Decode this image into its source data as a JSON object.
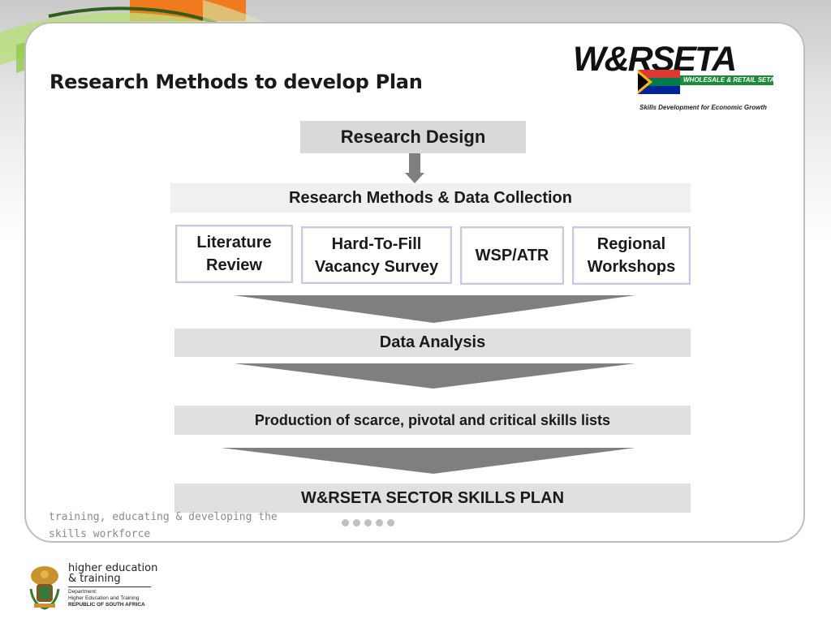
{
  "slide": {
    "title": "Research Methods to develop Plan",
    "footer_tagline": "training, educating & developing the\nskills workforce"
  },
  "logo": {
    "name": "W&RSETA",
    "band_text": "WHOLESALE & RETAIL SETA",
    "tagline": "Skills Development for Economic Growth"
  },
  "diagram": {
    "research_design": "Research Design",
    "methods_header": "Research Methods & Data Collection",
    "methods": [
      {
        "label": "Literature\nReview"
      },
      {
        "label": "Hard-To-Fill\nVacancy Survey"
      },
      {
        "label": "WSP/ATR"
      },
      {
        "label": "Regional\nWorkshops"
      }
    ],
    "data_analysis": "Data Analysis",
    "production": "Production of scarce, pivotal and critical skills lists",
    "final": "W&RSETA SECTOR SKILLS PLAN"
  },
  "department": {
    "title_line1": "higher education",
    "title_line2": "& training",
    "small_line1": "Department:",
    "small_line2": "Higher Education and Training",
    "small_line3": "REPUBLIC OF SOUTH AFRICA"
  },
  "colors": {
    "accent_orange": "#f07b1c",
    "arrow_gray": "#7f7f7f",
    "logo_green": "#1e8a3c",
    "method_border": "#c8c8e6"
  }
}
